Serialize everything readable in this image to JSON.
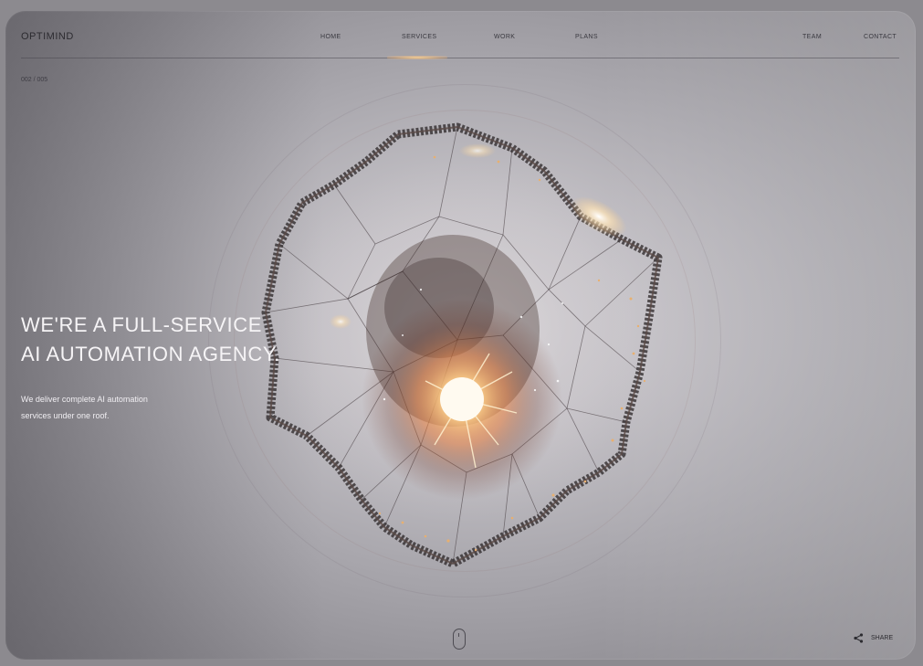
{
  "brand": {
    "logo": "OPTIMIND"
  },
  "nav": {
    "items": [
      {
        "label": "HOME"
      },
      {
        "label": "SERVICES"
      },
      {
        "label": "WORK"
      },
      {
        "label": "PLANS"
      },
      {
        "label": "TEAM"
      },
      {
        "label": "CONTACT"
      }
    ],
    "active_item": "SERVICES",
    "active_indicator_color": "#ffd08a"
  },
  "slide_counter": "002 / 005",
  "hero": {
    "headline_line1": "WE'RE A FULL-SERVICE",
    "headline_line2": "AI AUTOMATION AGENCY.",
    "subtext_line1": "We deliver complete AI automation",
    "subtext_line2": "services under one roof."
  },
  "scroll_indicator": {
    "icon": "mouse-icon"
  },
  "share": {
    "label": "SHARE",
    "icon": "share-icon"
  },
  "colors": {
    "background": "#b9b6bb",
    "text_dark": "#2c2b30",
    "text_light": "#f6f4f6",
    "glow": "#ffb458"
  }
}
